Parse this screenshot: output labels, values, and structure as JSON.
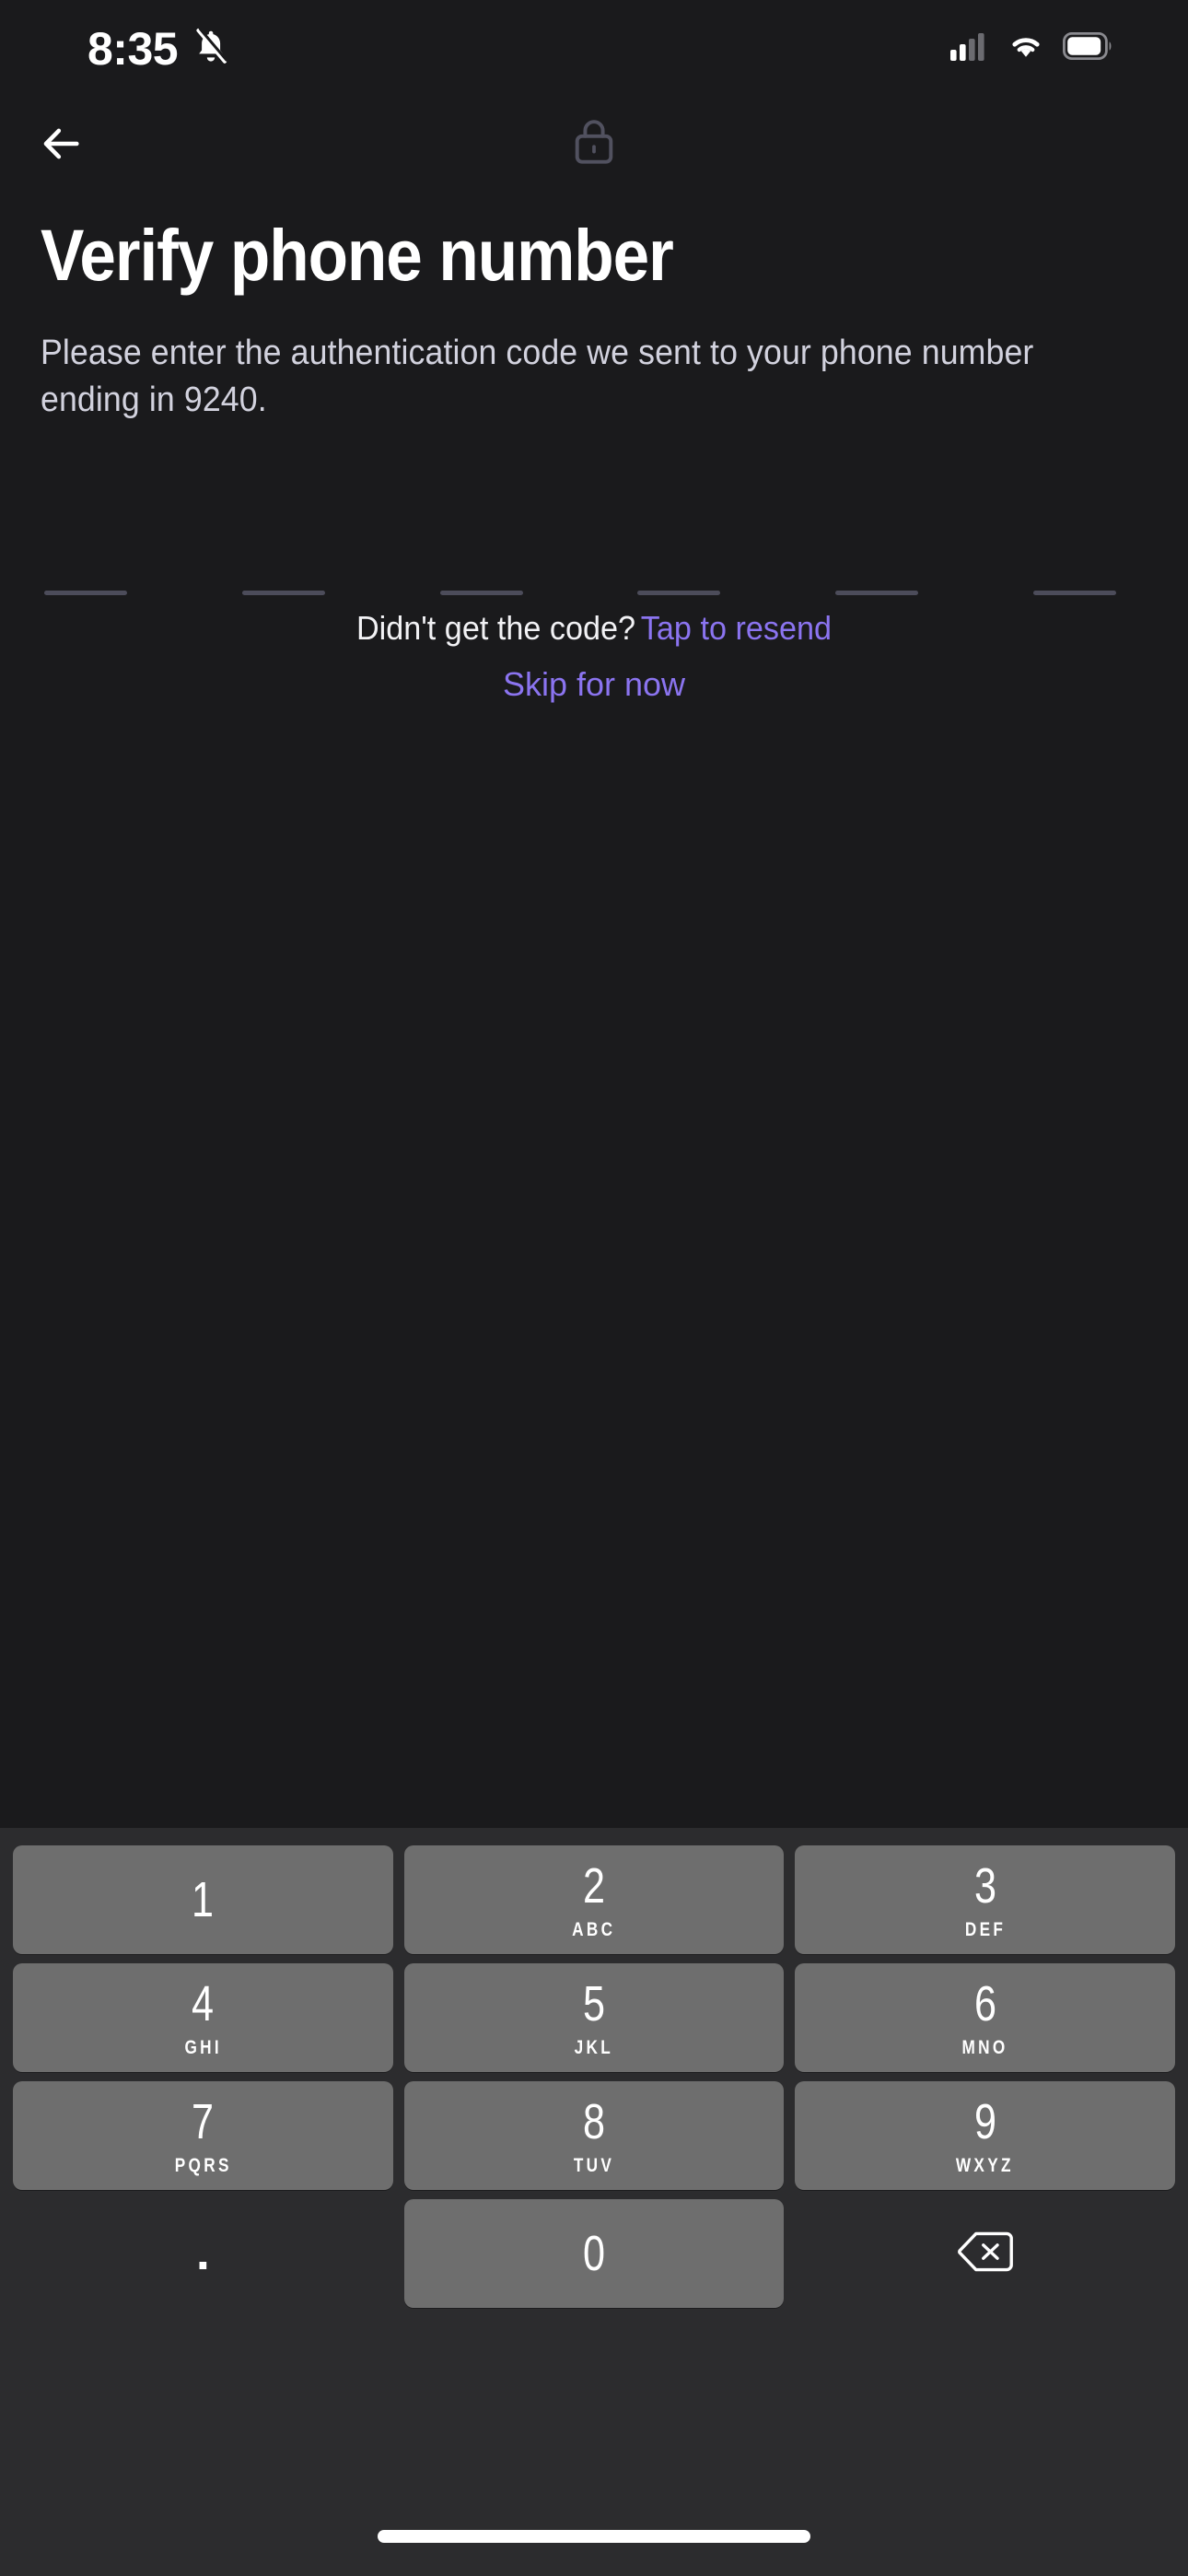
{
  "status_bar": {
    "time": "8:35",
    "notifications_muted_icon": "bell-slash-icon",
    "cellular_icon": "cellular-signal-icon",
    "wifi_icon": "wifi-icon",
    "battery_icon": "battery-icon"
  },
  "top_bar": {
    "back_icon": "back-arrow-icon",
    "lock_icon": "lock-icon"
  },
  "screen": {
    "title": "Verify phone number",
    "subtitle": "Please enter the authentication code we sent to your phone number ending in 9240."
  },
  "otp": {
    "length": 6,
    "values": [
      "",
      "",
      "",
      "",
      "",
      ""
    ]
  },
  "resend": {
    "question": "Didn't get the code?",
    "link": "Tap to resend"
  },
  "skip": {
    "label": "Skip for now"
  },
  "keypad": {
    "rows": [
      [
        {
          "digit": "1",
          "letters": ""
        },
        {
          "digit": "2",
          "letters": "ABC"
        },
        {
          "digit": "3",
          "letters": "DEF"
        }
      ],
      [
        {
          "digit": "4",
          "letters": "GHI"
        },
        {
          "digit": "5",
          "letters": "JKL"
        },
        {
          "digit": "6",
          "letters": "MNO"
        }
      ],
      [
        {
          "digit": "7",
          "letters": "PQRS"
        },
        {
          "digit": "8",
          "letters": "TUV"
        },
        {
          "digit": "9",
          "letters": "WXYZ"
        }
      ]
    ],
    "decimal": ".",
    "zero": "0",
    "backspace_icon": "backspace-delete-icon"
  },
  "colors": {
    "background": "#1a1a1c",
    "keypad_background": "#2c2c2e",
    "key_fill": "#6e6e6e",
    "accent_purple": "#8b74f0",
    "otp_underline": "#4c4c5a",
    "title_text": "#ffffff",
    "subtitle_text": "#d2d2de"
  }
}
